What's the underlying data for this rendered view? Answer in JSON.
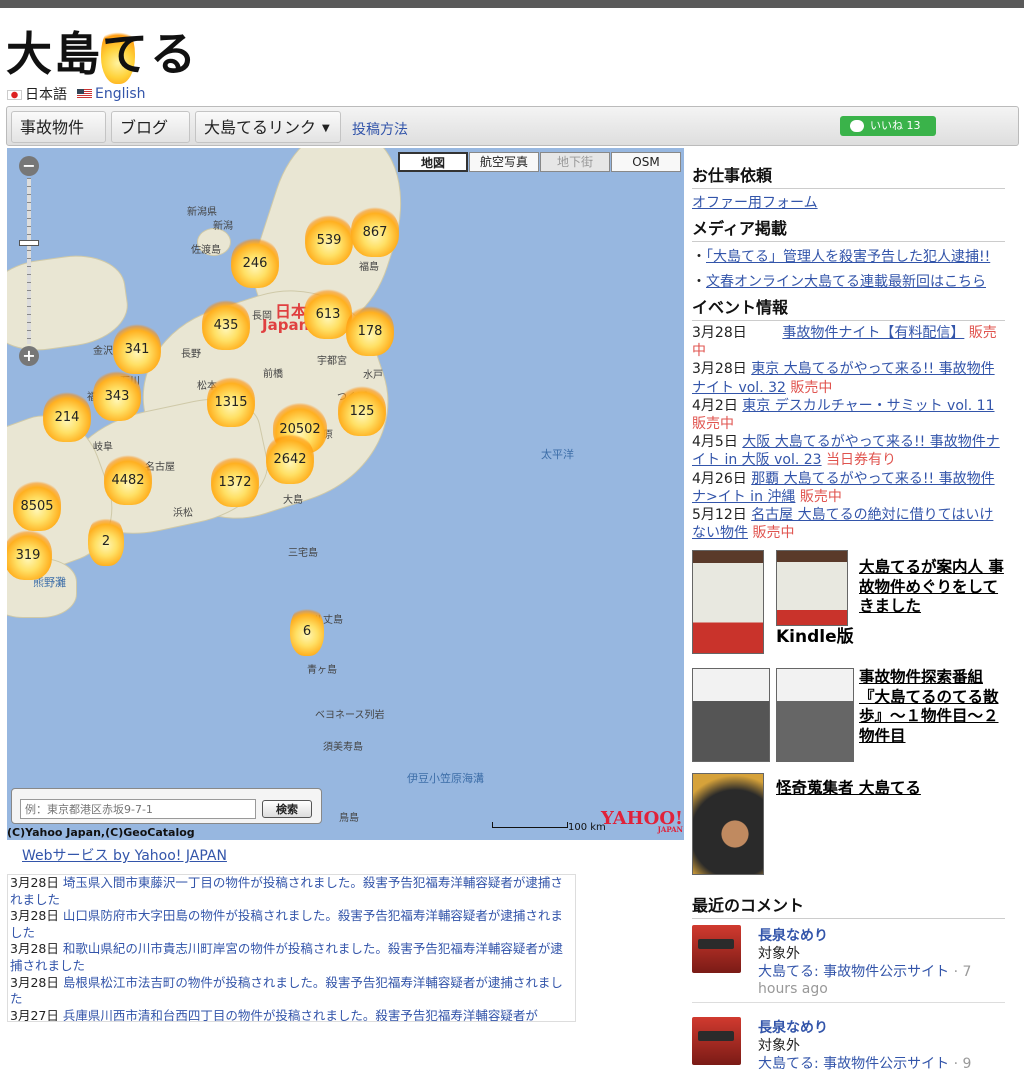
{
  "site": {
    "logo_text": "大島てる"
  },
  "lang": {
    "ja": "日本語",
    "en": "English"
  },
  "nav": {
    "items": [
      "事故物件",
      "ブログ",
      "大島てるリンク"
    ],
    "post_link": "投稿方法",
    "line_like": "いいね 13"
  },
  "map": {
    "types": [
      "地図",
      "航空写真",
      "地下街",
      "OSM"
    ],
    "clusters": [
      "539",
      "867",
      "246",
      "435",
      "613",
      "178",
      "341",
      "343",
      "1315",
      "20502",
      "125",
      "214",
      "4482",
      "2642",
      "1372",
      "8505",
      "2",
      "319",
      "6"
    ],
    "places": [
      "佐渡島",
      "新潟",
      "長岡",
      "金沢",
      "長野",
      "松本",
      "前橋",
      "宇都宮",
      "水戸",
      "福島",
      "岐阜",
      "浜松",
      "大島",
      "三宅島",
      "八丈島",
      "青ヶ島",
      "ベヨネース列岩",
      "須美寿島",
      "伊豆小笠原海溝",
      "太平洋",
      "熊野灘",
      "鳥島",
      "石川",
      "福井",
      "名古屋",
      "相模原",
      "つくば",
      "新潟県"
    ],
    "big_label_jp": "日本",
    "big_label_en": "Japan",
    "search_placeholder": "例：東京都港区赤坂9-7-1",
    "search_button": "検索",
    "copyright": "(C)Yahoo Japan,(C)GeoCatalog",
    "scale": "100 km",
    "provider": "YAHOO!",
    "provider_sub": "JAPAN"
  },
  "webservice": "Webサービス by Yahoo! JAPAN",
  "news": [
    {
      "date": "3月28日",
      "text": "埼玉県入間市東藤沢一丁目の物件が投稿されました。殺害予告犯福寿洋輔容疑者が逮捕されました"
    },
    {
      "date": "3月28日",
      "text": "山口県防府市大字田島の物件が投稿されました。殺害予告犯福寿洋輔容疑者が逮捕されました"
    },
    {
      "date": "3月28日",
      "text": "和歌山県紀の川市貴志川町岸宮の物件が投稿されました。殺害予告犯福寿洋輔容疑者が逮捕されました"
    },
    {
      "date": "3月28日",
      "text": "島根県松江市法吉町の物件が投稿されました。殺害予告犯福寿洋輔容疑者が逮捕されました"
    },
    {
      "date": "3月27日",
      "text": "兵庫県川西市清和台西四丁目の物件が投稿されました。殺害予告犯福寿洋輔容疑者が"
    }
  ],
  "sidebar": {
    "work_title": "お仕事依頼",
    "work_link": "オファー用フォーム",
    "media_title": "メディア掲載",
    "media_items": [
      "「大島てる」管理人を殺害予告した犯人逮捕!!",
      "文春オンライン大島てる連載最新回はこちら"
    ],
    "event_title": "イベント情報",
    "events": [
      {
        "date": "3月28日",
        "text": "事故物件ナイト【有料配信】",
        "status": "販売中"
      },
      {
        "date": "3月28日",
        "text": "東京 大島てるがやって来る!! 事故物件ナイト vol. 32",
        "status": "販売中"
      },
      {
        "date": "4月2日",
        "text": "東京 デスカルチャー・サミット vol. 11",
        "status": "販売中"
      },
      {
        "date": "4月5日",
        "text": "大阪 大島てるがやって来る!! 事故物件ナイト in 大阪 vol. 23",
        "status": "当日券有り"
      },
      {
        "date": "4月26日",
        "text": "那覇 大島てるがやって来る!! 事故物件ナ>イト in 沖縄",
        "status": "販売中"
      },
      {
        "date": "5月12日",
        "text": "名古屋 大島てるの絶対に借りてはいけない物件",
        "status": "販売中"
      }
    ],
    "book1": "大島てるが案内人 事故物件めぐりをしてきました",
    "kindle": "Kindle版",
    "book2": "事故物件探索番組『大島てるのてる散歩』～１物件目～２物件目",
    "book3": "怪奇蒐集者 大島てる",
    "comments_title": "最近のコメント",
    "comments": [
      {
        "name": "長泉なめり",
        "sub": "対象外",
        "src": "大島てる: 事故物件公示サイト",
        "ago": "· 7 hours ago"
      },
      {
        "name": "長泉なめり",
        "sub": "対象外",
        "src": "大島てる: 事故物件公示サイト",
        "ago": "· 9"
      }
    ]
  }
}
